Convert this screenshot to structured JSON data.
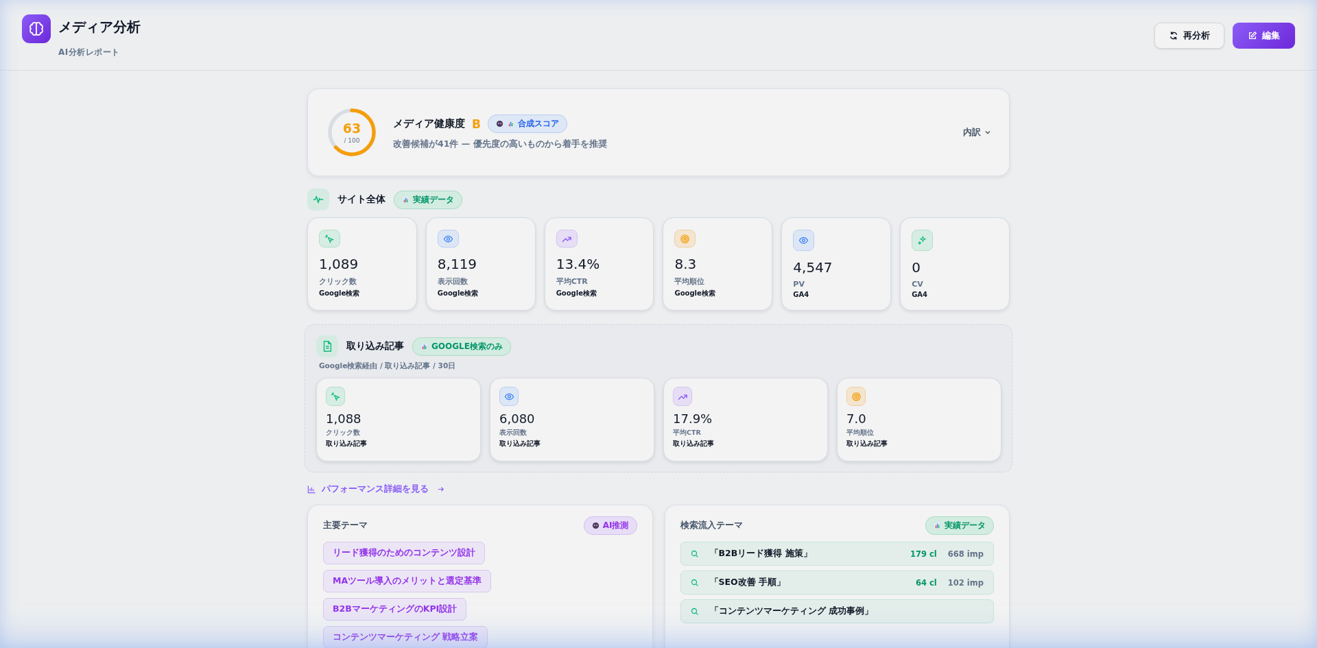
{
  "header": {
    "title": "メディア分析",
    "subtitle": "AI分析レポート",
    "buttons": [
      {
        "label": "再分析",
        "kind": "secondary"
      },
      {
        "label": "編集",
        "kind": "primary"
      }
    ]
  },
  "health": {
    "score": "63",
    "max": "/ 100",
    "level": 0.63,
    "title": "メディア健康度",
    "grade": "B",
    "badge": {
      "label": "合成スコア",
      "kind": "composite"
    },
    "description": "改善候補が41件 — 優先度の高いものから着手を推奨",
    "toggle": "内訳"
  },
  "site": {
    "title": "サイト全体",
    "badge": {
      "label": "実績データ",
      "kind": "actual"
    },
    "metrics": [
      {
        "kind": "click",
        "value": "1,089",
        "label": "クリック数",
        "source": "Google検索"
      },
      {
        "kind": "eye",
        "value": "8,119",
        "label": "表示回数",
        "source": "Google検索"
      },
      {
        "kind": "trend",
        "value": "13.4%",
        "label": "平均CTR",
        "source": "Google検索"
      },
      {
        "kind": "target",
        "value": "8.3",
        "label": "平均順位",
        "source": "Google検索"
      },
      {
        "kind": "eye",
        "value": "4,547",
        "label": "PV",
        "source": "GA4"
      },
      {
        "kind": "sparkle",
        "value": "0",
        "label": "CV",
        "source": "GA4"
      }
    ]
  },
  "imported": {
    "title": "取り込み記事",
    "badge": {
      "label": "GOOGLE検索のみ",
      "kind": "actual"
    },
    "subtitle": "Google検索経由 / 取り込み記事 / 30日",
    "metrics": [
      {
        "kind": "click",
        "value": "1,088",
        "label": "クリック数",
        "source": "取り込み記事"
      },
      {
        "kind": "eye",
        "value": "6,080",
        "label": "表示回数",
        "source": "取り込み記事"
      },
      {
        "kind": "trend",
        "value": "17.9%",
        "label": "平均CTR",
        "source": "取り込み記事"
      },
      {
        "kind": "target",
        "value": "7.0",
        "label": "平均順位",
        "source": "取り込み記事"
      }
    ]
  },
  "performance_link": "パフォーマンス詳細を見る",
  "themes": {
    "title": "主要テーマ",
    "badge": {
      "label": "AI推測",
      "kind": "ai"
    },
    "tags": [
      "リード獲得のためのコンテンツ設計",
      "MAツール導入のメリットと選定基準",
      "B2BマーケティングのKPI設計",
      "コンテンツマーケティング 戦略立案"
    ]
  },
  "search_themes": {
    "title": "検索流入テーマ",
    "badge": {
      "label": "実績データ",
      "kind": "actual"
    },
    "rows": [
      {
        "query": "「B2Bリード獲得 施策」",
        "clicks": "179 cl",
        "impressions": "668 imp"
      },
      {
        "query": "「SEO改善 手順」",
        "clicks": "64 cl",
        "impressions": "102 imp"
      },
      {
        "query": "「コンテンツマーケティング 成功事例」"
      }
    ]
  }
}
